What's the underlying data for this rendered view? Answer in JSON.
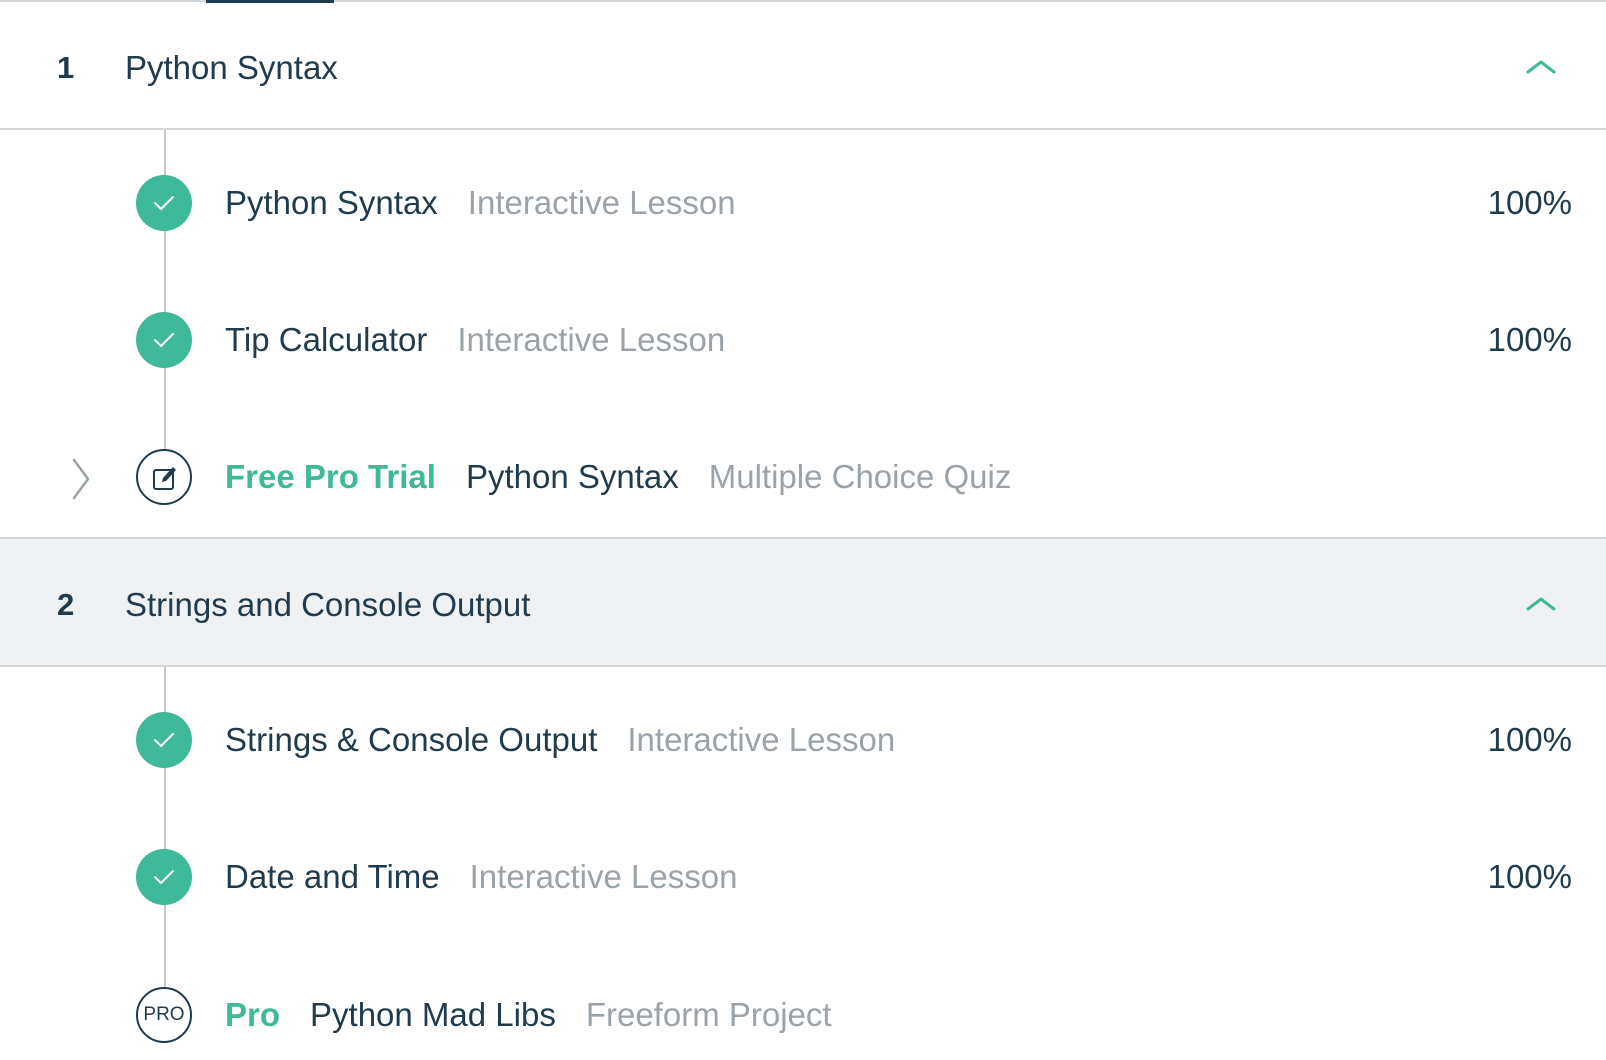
{
  "colors": {
    "accent": "#3eb99a",
    "text_primary": "#1f3b4d",
    "text_secondary": "#9aa3a9",
    "header_shaded_bg": "#f0f1f2",
    "divider": "#d3d7da"
  },
  "sections": [
    {
      "number": "1",
      "title": "Python Syntax",
      "expanded_icon": "chevron-up-icon",
      "items": [
        {
          "status": "complete",
          "icon": "check-icon",
          "tag": "",
          "title": "Python Syntax",
          "type": "Interactive Lesson",
          "progress": "100%"
        },
        {
          "status": "complete",
          "icon": "check-icon",
          "tag": "",
          "title": "Tip Calculator",
          "type": "Interactive Lesson",
          "progress": "100%"
        },
        {
          "status": "locked",
          "icon": "quiz-edit-icon",
          "tag": "Free Pro Trial",
          "title": "Python Syntax",
          "type": "Multiple Choice Quiz",
          "progress": "",
          "side_icon": "chevron-right-icon"
        }
      ]
    },
    {
      "number": "2",
      "title": "Strings and Console Output",
      "expanded_icon": "chevron-up-icon",
      "items": [
        {
          "status": "complete",
          "icon": "check-icon",
          "tag": "",
          "title": "Strings & Console Output",
          "type": "Interactive Lesson",
          "progress": "100%"
        },
        {
          "status": "complete",
          "icon": "check-icon",
          "tag": "",
          "title": "Date and Time",
          "type": "Interactive Lesson",
          "progress": "100%"
        },
        {
          "status": "pro",
          "icon": "pro-badge-icon",
          "icon_text": "PRO",
          "tag": "Pro",
          "title": "Python Mad Libs",
          "type": "Freeform Project",
          "progress": ""
        }
      ]
    }
  ]
}
